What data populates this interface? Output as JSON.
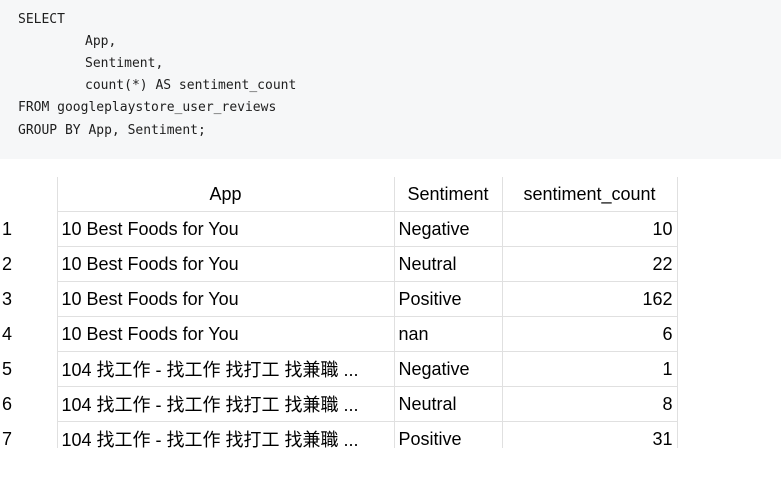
{
  "query": {
    "line1": "SELECT",
    "line2": "App,",
    "line3": "Sentiment,",
    "line4": "count(*) AS sentiment_count",
    "line5": "FROM googleplaystore_user_reviews",
    "line6": "GROUP BY App, Sentiment;"
  },
  "result": {
    "columns": [
      "App",
      "Sentiment",
      "sentiment_count"
    ],
    "rows": [
      {
        "index": "1",
        "app": "10 Best Foods for You",
        "sentiment": "Negative",
        "count": "10"
      },
      {
        "index": "2",
        "app": "10 Best Foods for You",
        "sentiment": "Neutral",
        "count": "22"
      },
      {
        "index": "3",
        "app": "10 Best Foods for You",
        "sentiment": "Positive",
        "count": "162"
      },
      {
        "index": "4",
        "app": "10 Best Foods for You",
        "sentiment": "nan",
        "count": "6"
      },
      {
        "index": "5",
        "app": "104 找工作 - 找工作 找打工 找兼職 ...",
        "sentiment": "Negative",
        "count": "1"
      },
      {
        "index": "6",
        "app": "104 找工作 - 找工作 找打工 找兼職 ...",
        "sentiment": "Neutral",
        "count": "8"
      },
      {
        "index": "7",
        "app": "104 找工作 - 找工作 找打工 找兼職 ...",
        "sentiment": "Positive",
        "count": "31"
      }
    ]
  }
}
